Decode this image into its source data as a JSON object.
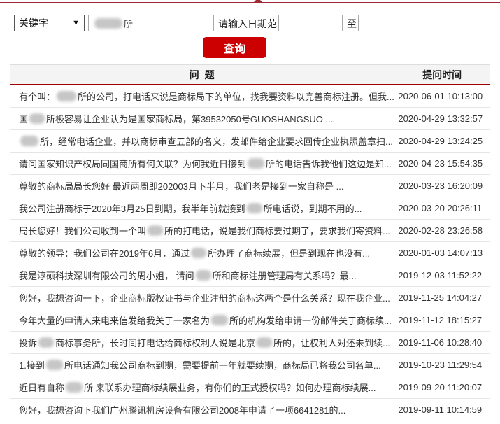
{
  "colors": {
    "top_line": "#9e2a36",
    "button_red": "#cc0000",
    "header_rule": "#a00000",
    "header_bg": "#f4f4f4"
  },
  "search_form": {
    "keyword_select_value": "关键字",
    "keyword_input_visible_text": "所",
    "date_range_label": "请输入日期范围",
    "date_from_value": "",
    "date_to_separator": "至",
    "date_to_value": "",
    "submit_label": "查询"
  },
  "table": {
    "headers": {
      "question": "问 题",
      "time": "提问时间"
    },
    "rows": [
      {
        "parts": [
          {
            "t": "有个叫："
          },
          {
            "blur": 28
          },
          {
            "t": "所的公司，打电话来说是商标局下的单位，找我要资料以完善商标注册。但我..."
          }
        ],
        "time": "2020-06-01 10:13:00"
      },
      {
        "parts": [
          {
            "t": "国"
          },
          {
            "blur": 22
          },
          {
            "t": "所极容易让企业认为是国家商标局，第39532050号GUOSHANGSUO ..."
          }
        ],
        "time": "2020-04-29 13:32:57"
      },
      {
        "parts": [
          {
            "blur": 26
          },
          {
            "t": "所，经常电话企业，并以商标审查五部的名义，发邮件给企业要求回传企业执照盖章扫..."
          }
        ],
        "time": "2020-04-29 13:24:25"
      },
      {
        "parts": [
          {
            "t": "请问国家知识产权局同国商所有何关联？为何我近日接到"
          },
          {
            "blur": 24
          },
          {
            "t": "所的电话告诉我他们这边是知..."
          }
        ],
        "time": "2020-04-23 15:54:35"
      },
      {
        "parts": [
          {
            "t": "尊敬的商标局局长您好 最近两周即202003月下半月，我们老是接到一家自称是 ..."
          }
        ],
        "time": "2020-03-23 16:20:09"
      },
      {
        "parts": [
          {
            "t": "我公司注册商标于2020年3月25日到期，我半年前就接到"
          },
          {
            "blur": 22
          },
          {
            "t": "所电话说，到期不用的..."
          }
        ],
        "time": "2020-03-20 20:26:11"
      },
      {
        "parts": [
          {
            "t": "局长您好！我们公司收到一个叫"
          },
          {
            "blur": 22
          },
          {
            "t": "所的打电话，说是我们商标要过期了，要求我们寄资料..."
          }
        ],
        "time": "2020-02-28 23:26:58"
      },
      {
        "parts": [
          {
            "t": "尊敬的领导：我们公司在2019年6月，通过"
          },
          {
            "blur": 22
          },
          {
            "t": "所办理了商标续展，但是到现在也没有..."
          }
        ],
        "time": "2020-01-03 14:07:13"
      },
      {
        "parts": [
          {
            "t": "我是淳硕科技深圳有限公司的周小姐， 请问"
          },
          {
            "blur": 22
          },
          {
            "t": "所和商标注册管理局有关系吗？最..."
          }
        ],
        "time": "2019-12-03 11:52:22"
      },
      {
        "parts": [
          {
            "t": "您好，我想咨询一下，企业商标版权证书与企业注册的商标这两个是什么关系？现在我企业..."
          }
        ],
        "time": "2019-11-25 14:04:27"
      },
      {
        "parts": [
          {
            "t": "今年大量的申请人来电来信发给我关于一家名为"
          },
          {
            "blur": 24
          },
          {
            "t": "所的机构发给申请一份邮件关于商标续..."
          }
        ],
        "time": "2019-11-12 18:15:27"
      },
      {
        "parts": [
          {
            "t": "投诉"
          },
          {
            "blur": 22
          },
          {
            "t": "商标事务所，长时间打电话给商标权利人说是北京"
          },
          {
            "blur": 22
          },
          {
            "t": "所的，让权利人对还未到续..."
          }
        ],
        "time": "2019-11-06 10:28:40"
      },
      {
        "parts": [
          {
            "t": "1.接到"
          },
          {
            "blur": 24
          },
          {
            "t": "所电话通知我公司商标到期，需要提前一年就要续期，商标局已将我公司名单..."
          }
        ],
        "time": "2019-10-23 11:29:54"
      },
      {
        "parts": [
          {
            "t": "近日有自称"
          },
          {
            "blur": 24
          },
          {
            "t": "所 来联系办理商标续展业务，有你们的正式授权吗？如何办理商标续展..."
          }
        ],
        "time": "2019-09-20 11:20:07"
      },
      {
        "parts": [
          {
            "t": "您好，我想咨询下我们广州腾讯机房设备有限公司2008年申请了一项6641281的..."
          }
        ],
        "time": "2019-09-11 10:14:59"
      }
    ]
  }
}
